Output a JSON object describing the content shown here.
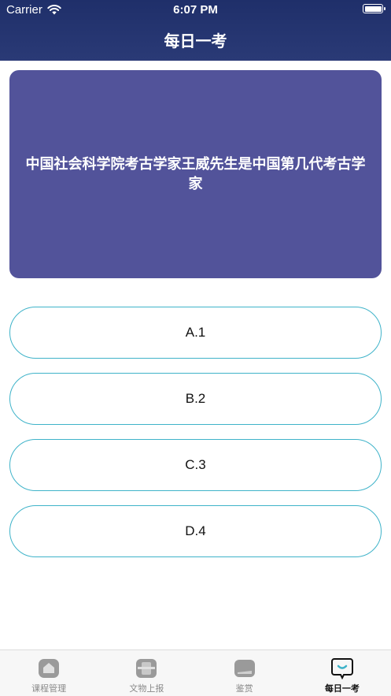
{
  "status_bar": {
    "carrier": "Carrier",
    "time": "6:07 PM"
  },
  "header": {
    "title": "每日一考"
  },
  "question": {
    "text": "中国社会科学院考古学家王威先生是中国第几代考古学家"
  },
  "options": [
    {
      "label": "A.1"
    },
    {
      "label": "B.2"
    },
    {
      "label": "C.3"
    },
    {
      "label": "D.4"
    }
  ],
  "tabbar": {
    "items": [
      {
        "label": "课程管理",
        "icon": "home-icon"
      },
      {
        "label": "文物上报",
        "icon": "upload-icon"
      },
      {
        "label": "鉴赏",
        "icon": "appreciation-icon"
      },
      {
        "label": "每日一考",
        "icon": "chat-quiz-icon"
      }
    ],
    "active_index": 3
  },
  "colors": {
    "header": "#2a3a76",
    "card": "#52539a",
    "option_border": "#3fb3c9",
    "active_icon": "#3fb3c9"
  }
}
